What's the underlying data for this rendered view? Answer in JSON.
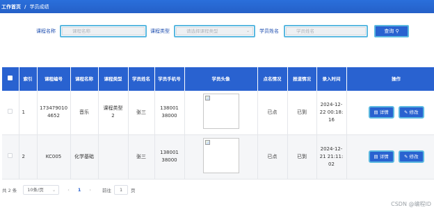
{
  "breadcrumb": {
    "home": "工作首页",
    "separator": "/",
    "current": "学员成绩"
  },
  "filters": {
    "course_name": {
      "label": "课程名称",
      "placeholder": "课程名称"
    },
    "course_type": {
      "label": "课程类型",
      "placeholder": "请选择课程类型"
    },
    "student_name": {
      "label": "学员姓名",
      "placeholder": "学员姓名"
    },
    "search_button": "查询",
    "search_icon": "search-icon",
    "select_icon": "chevron-down-icon"
  },
  "table": {
    "headers": [
      "索引",
      "课程编号",
      "课程名称",
      "课程类型",
      "学员姓名",
      "学员手机号",
      "学员头像",
      "点名情况",
      "报道情况",
      "录入时间",
      "操作"
    ],
    "rows": [
      {
        "index": "1",
        "course_no": "1734790104652",
        "course_name": "音乐",
        "course_type": "课程类型2",
        "student": "张三",
        "phone": "13800138000",
        "roll_call": "已点",
        "report": "已到",
        "time": "2024-12-22 00:18:16"
      },
      {
        "index": "2",
        "course_no": "KC005",
        "course_name": "化学基础",
        "course_type": "",
        "student": "张三",
        "phone": "13800138000",
        "roll_call": "已点",
        "report": "已到",
        "time": "2024-12-21 21:11:02"
      }
    ],
    "actions": {
      "detail": "详情",
      "edit": "修改"
    }
  },
  "pager": {
    "total": "共 2 条",
    "page_size": "10条/页",
    "prev": "‹",
    "current_page": "1",
    "next": "›",
    "goto_label": "前往",
    "goto_value": "1",
    "goto_unit": "页"
  },
  "watermark": "CSDN @编程ID",
  "colors": {
    "primary": "#2962d0",
    "accent_border": "#5ab8e0",
    "topbar": "#2a6fdb"
  }
}
